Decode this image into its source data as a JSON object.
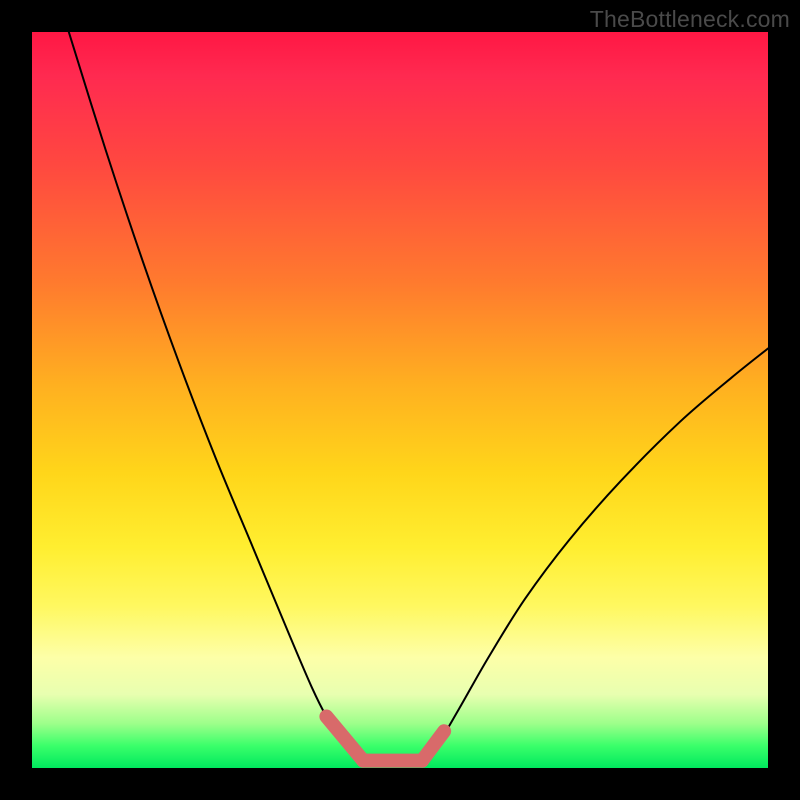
{
  "watermark": "TheBottleneck.com",
  "chart_data": {
    "type": "line",
    "title": "",
    "xlabel": "",
    "ylabel": "",
    "xlim": [
      0,
      100
    ],
    "ylim": [
      0,
      100
    ],
    "grid": false,
    "legend": false,
    "series": [
      {
        "name": "left-curve",
        "x": [
          5,
          10,
          15,
          20,
          25,
          30,
          35,
          38,
          40,
          42,
          44,
          45
        ],
        "values": [
          100,
          84,
          69,
          55,
          42,
          30,
          18,
          11,
          7,
          4,
          2,
          1
        ]
      },
      {
        "name": "flat-bottom",
        "x": [
          45,
          48,
          51,
          53
        ],
        "values": [
          1,
          0.5,
          0.5,
          1
        ]
      },
      {
        "name": "right-curve",
        "x": [
          53,
          55,
          58,
          62,
          67,
          73,
          80,
          88,
          95,
          100
        ],
        "values": [
          1,
          3,
          8,
          15,
          23,
          31,
          39,
          47,
          53,
          57
        ]
      }
    ],
    "overlay_segments": [
      {
        "name": "left-tip",
        "x": [
          40,
          45
        ],
        "values": [
          7,
          1
        ]
      },
      {
        "name": "bottom",
        "x": [
          45,
          53
        ],
        "values": [
          1,
          1
        ]
      },
      {
        "name": "right-tip",
        "x": [
          53,
          56
        ],
        "values": [
          1,
          5
        ]
      }
    ]
  }
}
